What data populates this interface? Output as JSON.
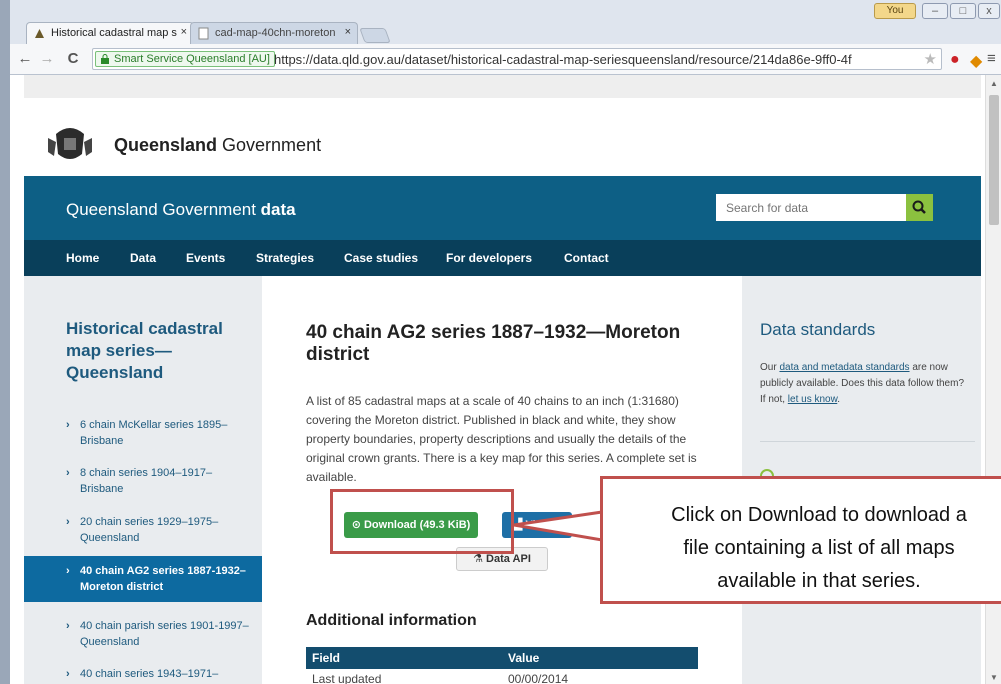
{
  "browser": {
    "tabs": [
      {
        "title": "Historical cadastral map s",
        "active": true
      },
      {
        "title": "cad-map-40chn-moreton",
        "active": false
      }
    ],
    "user_badge": "You",
    "identity": "Smart Service Queensland [AU]",
    "url": "https://data.qld.gov.au/dataset/historical-cadastral-map-seriesqueensland/resource/214da86e-9ff0-4f"
  },
  "header": {
    "gov_name_bold": "Queensland",
    "gov_name_rest": " Government"
  },
  "site": {
    "title_plain": "Queensland Government ",
    "title_bold": "data",
    "search_placeholder": "Search for data"
  },
  "nav": {
    "items": [
      "Home",
      "Data",
      "Events",
      "Strategies",
      "Case studies",
      "For developers",
      "Contact"
    ]
  },
  "sidebar": {
    "title": "Historical cadastral map series—Queensland",
    "items": [
      {
        "label": "6 chain McKellar series 1895–Brisbane",
        "active": false
      },
      {
        "label": "8 chain series 1904–1917–Brisbane",
        "active": false
      },
      {
        "label": "20 chain series 1929–1975–Queensland",
        "active": false
      },
      {
        "label": "40 chain AG2 series 1887-1932–Moreton district",
        "active": true
      },
      {
        "label": "40 chain parish series 1901-1997–Queensland",
        "active": false
      },
      {
        "label": "40 chain series 1943–1971–",
        "active": false
      }
    ]
  },
  "main": {
    "heading": "40 chain AG2 series 1887–1932—Moreton district",
    "description": "A list of 85 cadastral maps at a scale of 40 chains to an inch (1:31680) covering the Moreton district. Published in black and white, they show property boundaries, property descriptions and usually the details of the original crown grants. There is a key map for this series. A complete set is available.",
    "download_label": "Download (49.3 KiB)",
    "view_label": "Vi",
    "api_label": "Data API",
    "additional_heading": "Additional information",
    "table": {
      "headers": [
        "Field",
        "Value"
      ],
      "rows": [
        [
          "Last updated",
          "00/00/2014"
        ]
      ]
    }
  },
  "rightbar": {
    "title": "Data standards",
    "text_1": "Our ",
    "link_1": "data and metadata standards",
    "text_2": " are now publicly available. Does this data follow them? If not, ",
    "link_2": "let us know",
    "text_3": "."
  },
  "callout": {
    "line1": "Click on Download to download a",
    "line2": "file containing a list of all maps",
    "line3": "available in that series."
  },
  "colors": {
    "site_bar": "#0d5f85",
    "navbar": "#093f5a",
    "download_button": "#3a9b48",
    "annotation": "#c0504d"
  }
}
